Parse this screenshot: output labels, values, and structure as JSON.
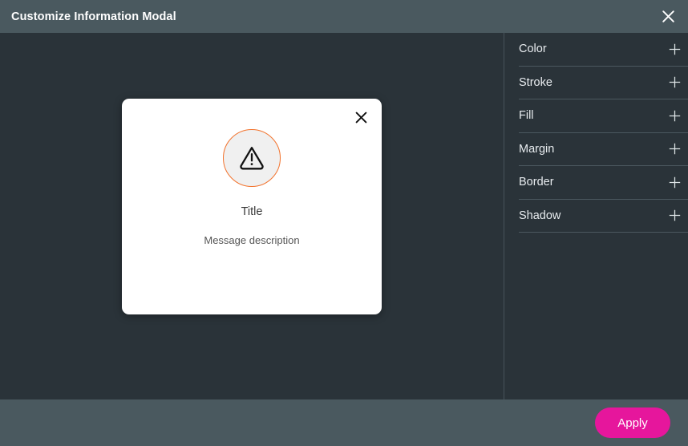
{
  "window": {
    "title": "Customize Information Modal",
    "close_icon": "close-icon"
  },
  "canvas": {
    "preview_modal": {
      "close_icon": "close-icon",
      "status_icon": "warning-triangle-icon",
      "title": "Title",
      "message": "Message description"
    }
  },
  "sidebar": {
    "items": [
      {
        "label": "Color",
        "expand_icon": "plus-icon"
      },
      {
        "label": "Stroke",
        "expand_icon": "plus-icon"
      },
      {
        "label": "Fill",
        "expand_icon": "plus-icon"
      },
      {
        "label": "Margin",
        "expand_icon": "plus-icon"
      },
      {
        "label": "Border",
        "expand_icon": "plus-icon"
      },
      {
        "label": "Shadow",
        "expand_icon": "plus-icon"
      }
    ]
  },
  "footer": {
    "apply_label": "Apply"
  },
  "colors": {
    "header_bg": "#4a595f",
    "body_bg": "#2a3339",
    "footer_bg": "#4a595f",
    "accent": "#e6169c",
    "warning_ring": "#f2722c",
    "divider": "#4b585f",
    "card_bg": "#ffffff"
  }
}
